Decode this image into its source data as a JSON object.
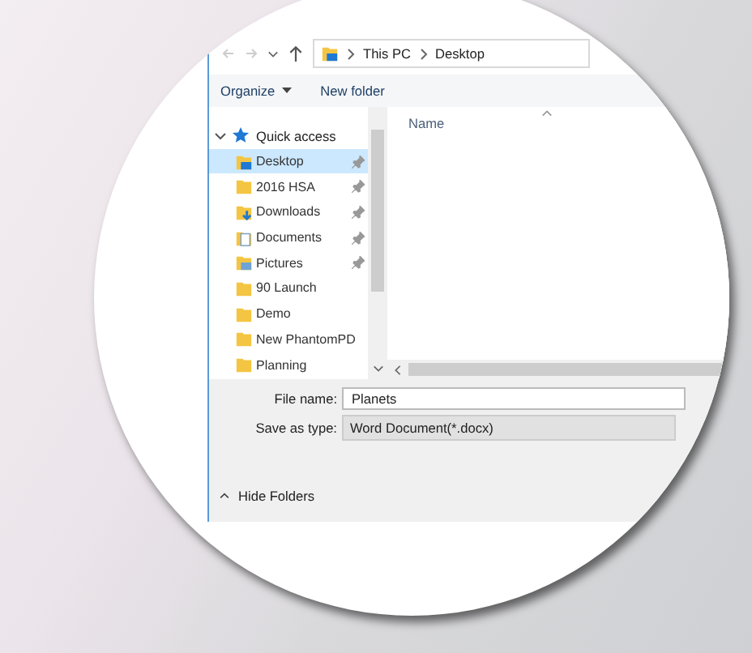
{
  "address_bar": {
    "path": [
      "This PC",
      "Desktop"
    ]
  },
  "toolbar": {
    "buttons": [
      {
        "label": "Organize",
        "dropdown": true
      },
      {
        "label": "New folder",
        "dropdown": false
      }
    ]
  },
  "navigation_pane": {
    "items": [
      {
        "label": "Quick access",
        "expanded": true,
        "selected": false,
        "children": [
          {
            "label": "Desktop",
            "kind": "desktop",
            "selected": true,
            "pinned": true
          },
          {
            "label": "2016 HSA",
            "kind": "folder",
            "selected": false,
            "pinned": true
          },
          {
            "label": "Downloads",
            "kind": "downloads",
            "selected": false,
            "pinned": true
          },
          {
            "label": "Documents",
            "kind": "documents",
            "selected": false,
            "pinned": true
          },
          {
            "label": "Pictures",
            "kind": "pictures",
            "selected": false,
            "pinned": true
          },
          {
            "label": "90 Launch",
            "kind": "folder",
            "selected": false,
            "pinned": false
          },
          {
            "label": "Demo",
            "kind": "folder",
            "selected": false,
            "pinned": false
          },
          {
            "label": "New PhantomPD",
            "kind": "folder",
            "selected": false,
            "pinned": false
          },
          {
            "label": "Planning",
            "kind": "folder",
            "selected": false,
            "pinned": false
          }
        ]
      }
    ]
  },
  "file_list": {
    "columns": [
      "Name"
    ]
  },
  "fields": [
    {
      "label": "File name:",
      "value": "Planets",
      "kind": "text"
    },
    {
      "label": "Save as type:",
      "value": "Word Document(*.docx)",
      "kind": "select"
    }
  ],
  "footer": {
    "toggle": "Hide Folders"
  }
}
